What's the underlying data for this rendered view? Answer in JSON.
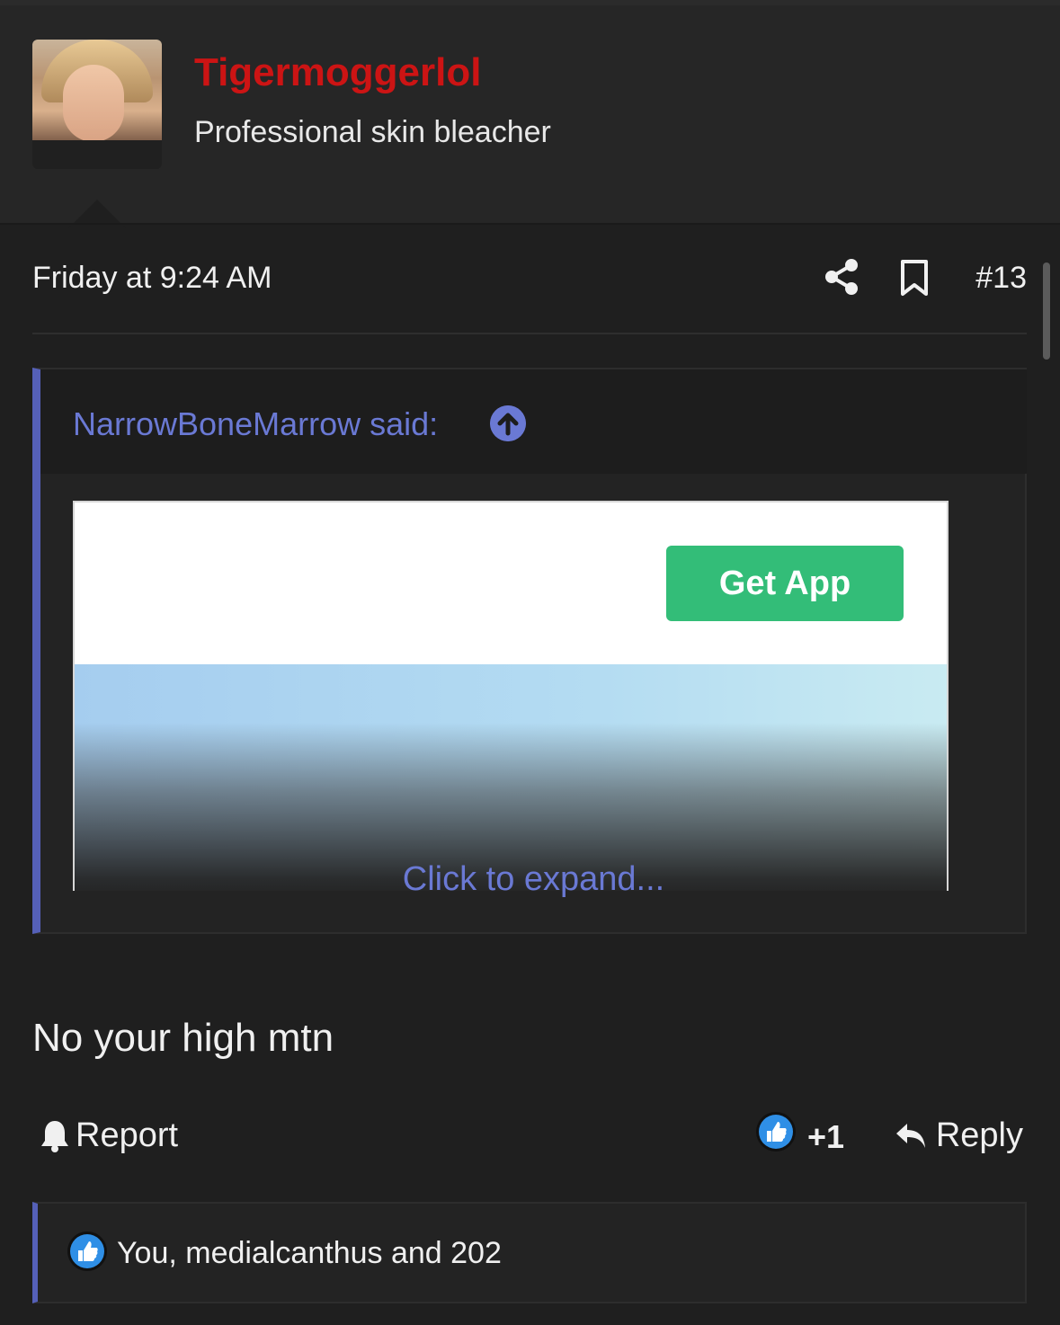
{
  "user": {
    "name": "Tigermoggerlol",
    "title": "Professional skin bleacher",
    "name_color": "#cc1414"
  },
  "post": {
    "date": "Friday at 9:24 AM",
    "number": "#13",
    "text": "No your high mtn"
  },
  "quote": {
    "author_line": "NarrowBoneMarrow said:",
    "embedded_button": "Get App",
    "expand_label": "Click to expand...",
    "accent_color": "#5560b8"
  },
  "actions": {
    "report": "Report",
    "like_count": "+1",
    "reply": "Reply"
  },
  "reactions": {
    "summary": "You, medialcanthus and 202"
  },
  "icons": {
    "share": "share-icon",
    "bookmark": "bookmark-icon",
    "bell": "bell-icon",
    "like": "thumbs-up-icon",
    "reply": "reply-arrow-icon",
    "quote_jump": "up-arrow-icon"
  }
}
